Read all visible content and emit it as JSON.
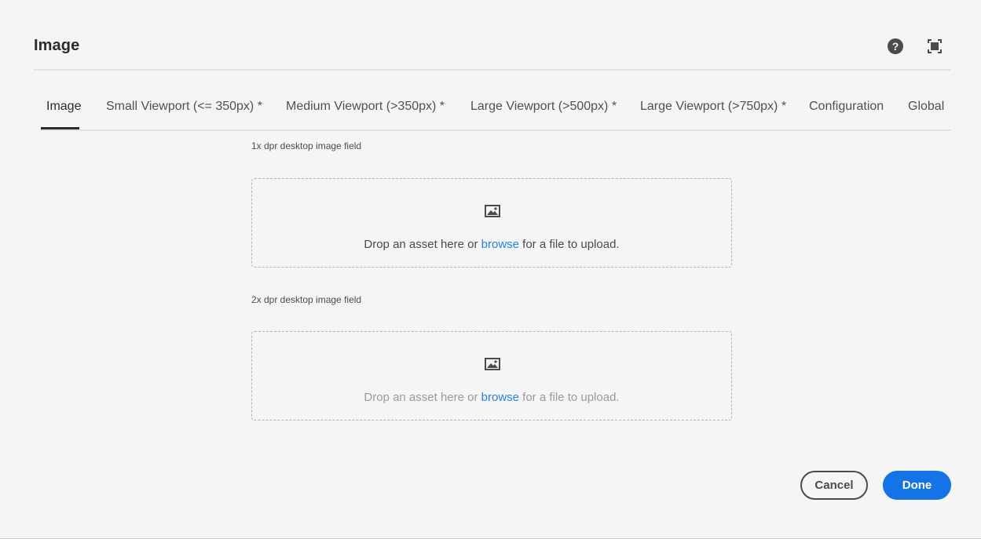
{
  "dialog": {
    "title": "Image",
    "help_icon": "help-icon",
    "help_glyph": "?",
    "fullscreen_icon": "fullscreen-icon"
  },
  "tabs": [
    {
      "label": "Image",
      "active": true
    },
    {
      "label": "Small Viewport (<= 350px) *",
      "active": false
    },
    {
      "label": "Medium Viewport (>350px) *",
      "active": false
    },
    {
      "label": "Large Viewport (>500px) *",
      "active": false
    },
    {
      "label": "Large Viewport (>750px) *",
      "active": false
    },
    {
      "label": "Configuration",
      "active": false
    },
    {
      "label": "Global",
      "active": false
    }
  ],
  "fields": [
    {
      "label": "1x dpr desktop image field",
      "icon": "image-icon",
      "text_before": "Drop an asset here or ",
      "link": "browse",
      "text_after": " for a file to upload."
    },
    {
      "label": "2x dpr desktop image field",
      "icon": "image-icon",
      "text_before": "Drop an asset here or ",
      "link": "browse",
      "text_after": " for a file to upload."
    }
  ],
  "footer": {
    "cancel_label": "Cancel",
    "done_label": "Done"
  },
  "colors": {
    "background": "#f5f5f5",
    "accent": "#1473e6",
    "link": "#2680eb",
    "text": "#2c2c2c"
  }
}
